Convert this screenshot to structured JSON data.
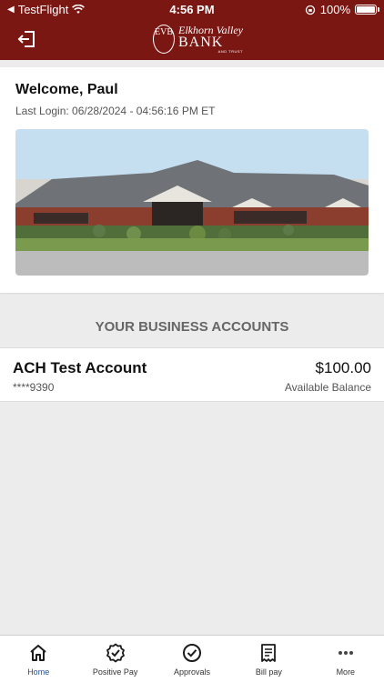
{
  "status_bar": {
    "carrier": "TestFlight",
    "time": "4:56 PM",
    "battery": "100%"
  },
  "header": {
    "logo_script": "Elkhorn Valley",
    "logo_bank": "BANK",
    "logo_trust": "AND TRUST",
    "logo_monogram": "EVB"
  },
  "welcome": {
    "title": "Welcome, Paul",
    "last_login": "Last Login: 06/28/2024 - 04:56:16 PM ET"
  },
  "accounts_section": {
    "heading": "YOUR BUSINESS ACCOUNTS",
    "accounts": [
      {
        "name": "ACH Test Account",
        "masked_number": "****9390",
        "balance": "$100.00",
        "balance_label": "Available Balance"
      }
    ]
  },
  "tabbar": {
    "tabs": [
      {
        "label": "Home",
        "icon": "home-icon",
        "active": true
      },
      {
        "label": "Positive Pay",
        "icon": "badge-check-icon",
        "active": false
      },
      {
        "label": "Approvals",
        "icon": "check-circle-icon",
        "active": false
      },
      {
        "label": "Bill pay",
        "icon": "receipt-icon",
        "active": false
      },
      {
        "label": "More",
        "icon": "more-icon",
        "active": false
      }
    ]
  },
  "colors": {
    "brand": "#7b1713",
    "active_tab": "#1d4f8c"
  }
}
